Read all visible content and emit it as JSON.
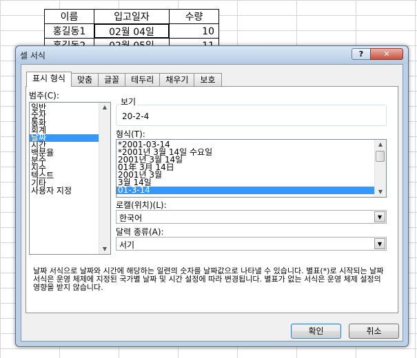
{
  "sheet": {
    "headers": [
      "이름",
      "입고일자",
      "수량"
    ],
    "row1": [
      "홍길동1",
      "02월 04일",
      "10"
    ],
    "row2": [
      "홍길동2",
      "02월 05일",
      "11"
    ]
  },
  "dialog": {
    "title": "셀 서식",
    "help_label": "?",
    "close_label": "✕",
    "tabs": [
      "표시 형식",
      "맞춤",
      "글꼴",
      "테두리",
      "채우기",
      "보호"
    ],
    "category_label": "범주(C):",
    "categories": [
      "일반",
      "숫자",
      "통화",
      "회계",
      "날짜",
      "시간",
      "백분율",
      "분수",
      "지수",
      "텍스트",
      "기타",
      "사용자 지정"
    ],
    "selected_category": "날짜",
    "sample_label": "보기",
    "sample_value": "20-2-4",
    "type_label": "형식(T):",
    "types": [
      "*2001-03-14",
      "*2001년 3월 14일 수요일",
      "2001년 3월 14일",
      "01年 3月 14日",
      "2001년 3월",
      "3월 14일",
      "01-3-14"
    ],
    "selected_type": "01-3-14",
    "locale_label": "로캘(위치)(L):",
    "locale_value": "한국어",
    "calendar_label": "달력 종류(A):",
    "calendar_value": "서기",
    "description": "날짜 서식으로 날짜와 시간에 해당하는 일련의 숫자를 날짜값으로 나타낼 수 있습니다. 별표(*)로 시작되는 날짜 서식은 운영 체제에 지정된 국가별 날짜 및 시간 설정에 따라 변경됩니다. 별표가 없는 서식은 운영 체제 설정의 영향을 받지 않습니다.",
    "ok_label": "확인",
    "cancel_label": "취소"
  }
}
